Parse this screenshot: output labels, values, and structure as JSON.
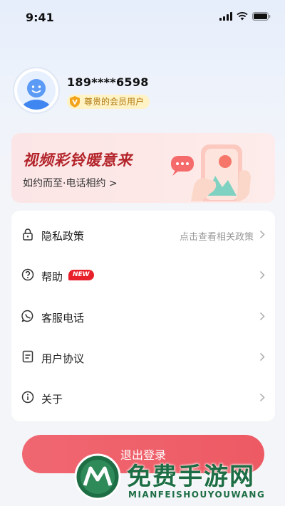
{
  "status_bar": {
    "time": "9:41"
  },
  "profile": {
    "phone": "189****6598",
    "badge": "尊贵的会员用户"
  },
  "banner": {
    "title": "视频彩铃暖意来",
    "subtitle": "如约而至·电话相约 >"
  },
  "menu": {
    "items": [
      {
        "label": "隐私政策",
        "hint": "点击查看相关政策",
        "icon": "lock-icon"
      },
      {
        "label": "帮助",
        "badge": "NEW",
        "icon": "question-icon"
      },
      {
        "label": "客服电话",
        "icon": "chat-bubble-icon"
      },
      {
        "label": "用户协议",
        "icon": "document-icon"
      },
      {
        "label": "关于",
        "icon": "info-icon"
      }
    ]
  },
  "logout_label": "退出登录",
  "watermark": {
    "title": "免费手游网",
    "subtitle": "MIANFEISHOUYOUWANG"
  },
  "colors": {
    "accent": "#ed5a64",
    "banner_title": "#b3242a",
    "badge_bg": "#fff2c4",
    "new_badge": "#e8202a"
  }
}
